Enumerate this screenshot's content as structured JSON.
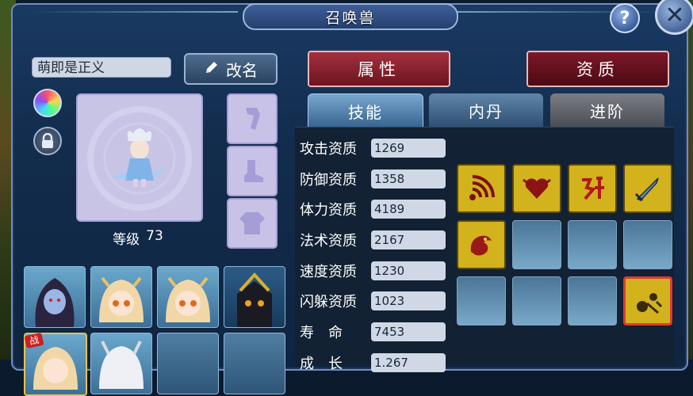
{
  "window": {
    "title": "召唤兽",
    "help_label": "?",
    "close_label": "✕"
  },
  "pet": {
    "name": "萌即是正义",
    "rename_label": "改名",
    "level_label": "等级",
    "level_value": "73"
  },
  "tabs": {
    "attributes": "属性",
    "aptitude": "资质",
    "skills": "技能",
    "inner_core": "内丹",
    "advance": "进阶"
  },
  "stats": [
    {
      "label": "攻击资质",
      "value": "1269"
    },
    {
      "label": "防御资质",
      "value": "1358"
    },
    {
      "label": "体力资质",
      "value": "4189"
    },
    {
      "label": "法术资质",
      "value": "2167"
    },
    {
      "label": "速度资质",
      "value": "1230"
    },
    {
      "label": "闪躲资质",
      "value": "1023"
    },
    {
      "label": "寿　命",
      "value": "7453"
    },
    {
      "label": "成　长",
      "value": "1.267"
    }
  ],
  "skills": [
    {
      "icon": "wave-arc-icon",
      "filled": true
    },
    {
      "icon": "heart-crest-icon",
      "filled": true
    },
    {
      "icon": "red-rune-icon",
      "filled": true
    },
    {
      "icon": "sword-icon",
      "filled": true
    },
    {
      "icon": "dragon-icon",
      "filled": true
    },
    {
      "icon": "empty",
      "filled": false
    },
    {
      "icon": "empty",
      "filled": false
    },
    {
      "icon": "empty",
      "filled": false
    },
    {
      "icon": "empty",
      "filled": false
    },
    {
      "icon": "empty",
      "filled": false
    },
    {
      "icon": "empty",
      "filled": false
    },
    {
      "icon": "meteor-icon",
      "filled": true,
      "selected": true
    }
  ],
  "pet_list": {
    "battle_badge": "战"
  },
  "colors": {
    "panel_bg": "#132d4e",
    "tab_red": "#8c1f2c",
    "skill_gold": "#d2b21d",
    "selected_border": "#e03a32"
  }
}
